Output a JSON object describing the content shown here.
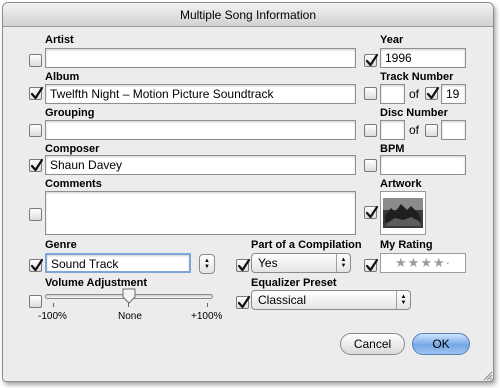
{
  "window": {
    "title": "Multiple Song Information"
  },
  "artist": {
    "label": "Artist",
    "value": "",
    "checked": false
  },
  "album": {
    "label": "Album",
    "value": "Twelfth Night – Motion Picture Soundtrack",
    "checked": true
  },
  "grouping": {
    "label": "Grouping",
    "value": "",
    "checked": false
  },
  "composer": {
    "label": "Composer",
    "value": "Shaun Davey",
    "checked": true
  },
  "comments": {
    "label": "Comments",
    "value": "",
    "checked": false
  },
  "genre": {
    "label": "Genre",
    "value": "Sound Track",
    "checked": true
  },
  "compilation": {
    "label": "Part of a Compilation",
    "value": "Yes",
    "checked": true
  },
  "volume": {
    "label": "Volume Adjustment",
    "min_label": "-100%",
    "mid_label": "None",
    "max_label": "+100%",
    "value": 0,
    "checked": false
  },
  "eq": {
    "label": "Equalizer Preset",
    "value": "Classical",
    "checked": true
  },
  "year": {
    "label": "Year",
    "value": "1996",
    "checked": true
  },
  "track": {
    "label": "Track Number",
    "of": "of",
    "number": "",
    "total": "19",
    "number_checked": false,
    "total_checked": true
  },
  "disc": {
    "label": "Disc Number",
    "of": "of",
    "number": "",
    "total": "",
    "number_checked": false,
    "total_checked": false
  },
  "bpm": {
    "label": "BPM",
    "value": "",
    "checked": false
  },
  "artwork": {
    "label": "Artwork",
    "checked": true
  },
  "rating": {
    "label": "My Rating",
    "stars": "★★★★·",
    "value": 4,
    "checked": true
  },
  "buttons": {
    "cancel": "Cancel",
    "ok": "OK"
  },
  "colors": {
    "accent": "#76a7e5",
    "window_bg": "#ececec"
  }
}
